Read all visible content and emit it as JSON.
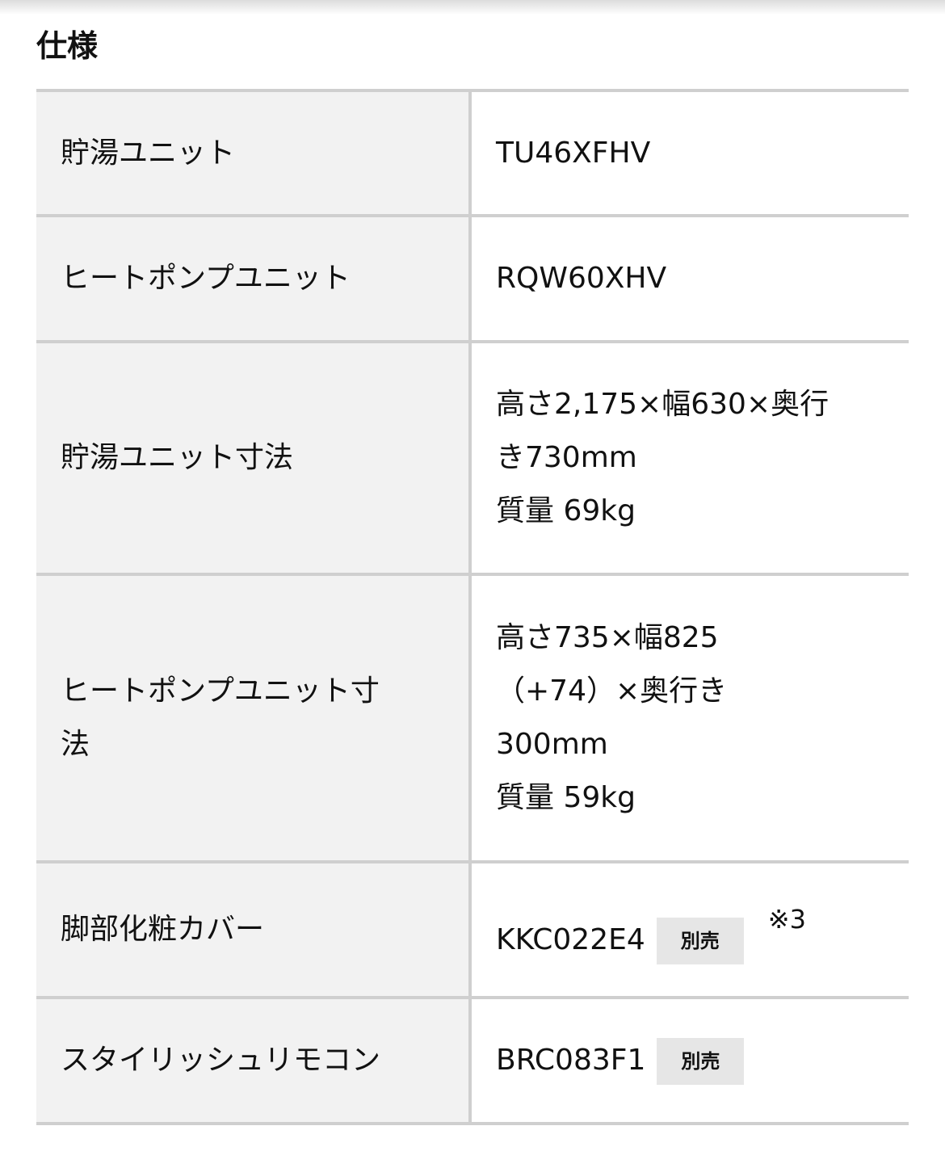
{
  "section": {
    "title": "仕様"
  },
  "colors": {
    "header_bg": "#f2f2f2",
    "border": "#cfcfcf",
    "badge_bg": "#e6e6e6"
  },
  "rows": [
    {
      "label": "貯湯ユニット",
      "value_lines": [
        "TU46XFHV"
      ]
    },
    {
      "label": "ヒートポンプユニット",
      "value_lines": [
        "RQW60XHV"
      ]
    },
    {
      "label": "貯湯ユニット寸法",
      "value_lines": [
        "高さ2,175×幅630×奥行",
        "き730mm",
        "質量 69kg"
      ]
    },
    {
      "label_lines": [
        "ヒートポンプユニット寸",
        "法"
      ],
      "value_lines": [
        "高さ735×幅825",
        "（+74）×奥行き",
        "300mm",
        "質量 59kg"
      ]
    },
    {
      "label": "脚部化粧カバー",
      "value": "KKC022E4",
      "badge": "別売",
      "note": "※3"
    },
    {
      "label": "スタイリッシュリモコン",
      "value": "BRC083F1",
      "badge": "別売"
    }
  ]
}
